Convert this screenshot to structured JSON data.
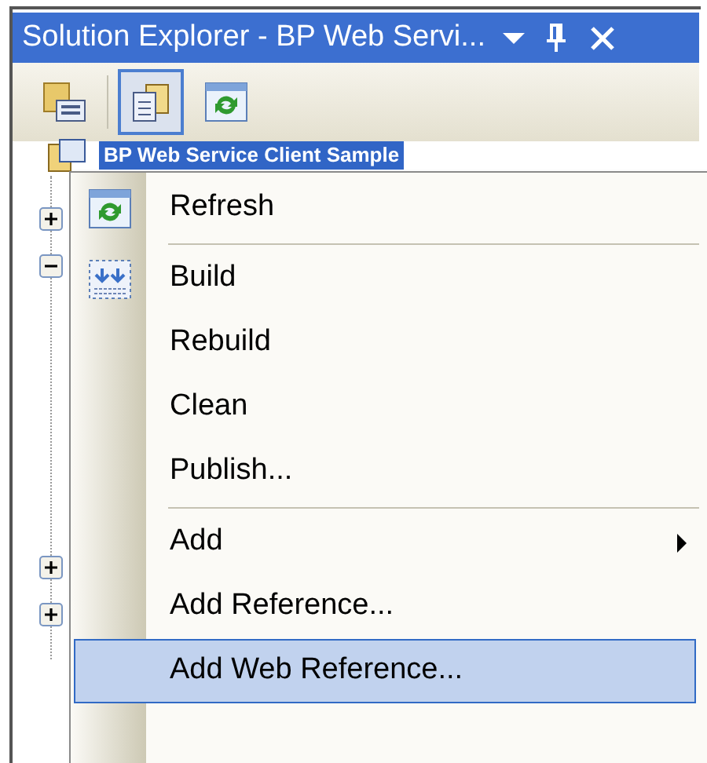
{
  "window": {
    "title": "Solution Explorer - BP Web Servi..."
  },
  "toolbar": [
    {
      "selected": false
    },
    {
      "selected": true
    },
    {
      "selected": false
    }
  ],
  "tree": {
    "root": {
      "label": "BP Web Service Client Sample",
      "selected": true
    },
    "expanders": [
      {
        "expanded": false
      },
      {
        "expanded": true
      },
      {
        "expanded": false
      },
      {
        "expanded": false
      }
    ]
  },
  "context_menu": [
    {
      "kind": "item",
      "label": "Refresh",
      "selected": false
    },
    {
      "kind": "separator"
    },
    {
      "kind": "item",
      "label": "Build",
      "selected": false
    },
    {
      "kind": "item",
      "label": "Rebuild",
      "selected": false
    },
    {
      "kind": "item",
      "label": "Clean",
      "selected": false
    },
    {
      "kind": "item",
      "label": "Publish...",
      "selected": false
    },
    {
      "kind": "separator"
    },
    {
      "kind": "item",
      "label": "Add",
      "submenu": true,
      "selected": false
    },
    {
      "kind": "item",
      "label": "Add Reference...",
      "selected": false
    },
    {
      "kind": "item",
      "label": "Add Web Reference...",
      "selected": true
    }
  ]
}
